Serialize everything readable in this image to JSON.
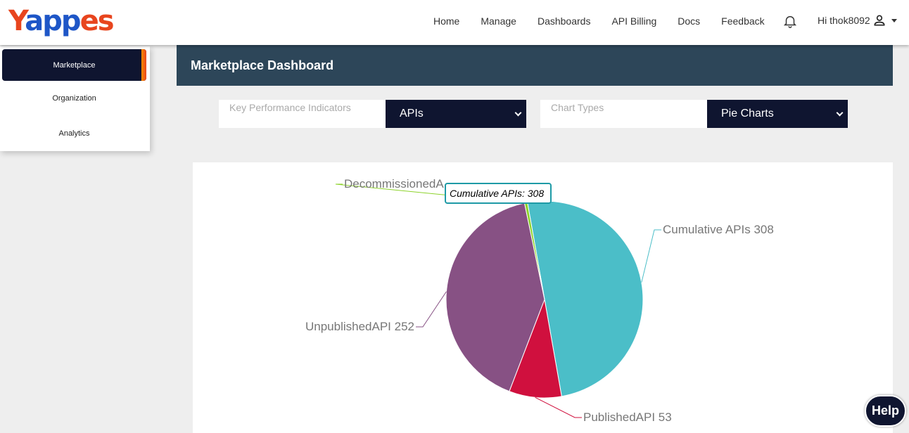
{
  "brand": {
    "logo_text": "Yappes"
  },
  "nav": {
    "items": [
      "Home",
      "Manage",
      "Dashboards",
      "API Billing",
      "Docs",
      "Feedback"
    ],
    "greeting": "Hi thok8092"
  },
  "sidebar": {
    "items": [
      {
        "label": "Marketplace",
        "active": true
      },
      {
        "label": "Organization",
        "active": false
      },
      {
        "label": "Analytics",
        "active": false
      }
    ]
  },
  "page": {
    "title": "Marketplace Dashboard"
  },
  "filters": {
    "kpi_label": "Key Performance Indicators",
    "kpi_value": "APIs",
    "chart_type_label": "Chart Types",
    "chart_type_value": "Pie Charts"
  },
  "tooltip": {
    "label": "Cumulative APIs:",
    "value": "308"
  },
  "help": {
    "label": "Help"
  },
  "colors": {
    "cumulative": "#4bbec8",
    "published": "#d0103e",
    "unpublished": "#875184",
    "decommissioned": "#8cd22a",
    "header_bg": "#2d4659",
    "dark_navy": "#0f1530"
  },
  "chart_data": {
    "type": "pie",
    "slices": [
      {
        "name": "Cumulative APIs",
        "value": 308,
        "label": "Cumulative APIs 308",
        "color": "#4bbec8"
      },
      {
        "name": "PublishedAPI",
        "value": 53,
        "label": "PublishedAPI 53",
        "color": "#d0103e"
      },
      {
        "name": "UnpublishedAPI",
        "value": 252,
        "label": "UnpublishedAPI 252",
        "color": "#875184"
      },
      {
        "name": "DecommissionedAPI",
        "value": 3,
        "label": "DecommissionedA",
        "color": "#8cd22a"
      }
    ]
  }
}
